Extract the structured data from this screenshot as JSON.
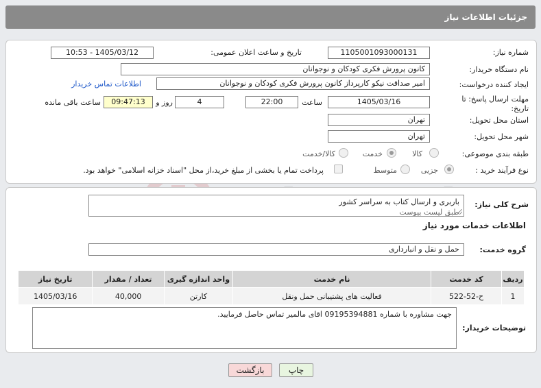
{
  "header": {
    "title": "جزئیات اطلاعات نیاز"
  },
  "form": {
    "need_number_label": "شماره نیاز:",
    "need_number": "1105001093000131",
    "announce_label": "تاریخ و ساعت اعلان عمومی:",
    "announce_value": "1405/03/12 - 10:53",
    "buyer_org_label": "نام دستگاه خریدار:",
    "buyer_org": "کانون پرورش فکری کودکان و نوجوانان",
    "creator_label": "ایجاد کننده درخواست:",
    "creator": "امیر صداقت نیکو کارپرداز کانون پرورش فکری کودکان و نوجوانان",
    "contact_link": "اطلاعات تماس خریدار",
    "deadline_label": "مهلت ارسال پاسخ: تا تاریخ:",
    "deadline_date": "1405/03/16",
    "time_label": "ساعت",
    "deadline_time": "22:00",
    "days_value": "4",
    "days_label": "روز و",
    "remaining_time": "09:47:13",
    "remaining_label": "ساعت باقی مانده",
    "province_label": "استان محل تحویل:",
    "province": "تهران",
    "city_label": "شهر محل تحویل:",
    "city": "تهران",
    "category_label": "طبقه بندی موضوعی:",
    "category_options": [
      "کالا",
      "خدمت",
      "کالا/خدمت"
    ],
    "category_selected": "خدمت",
    "process_label": "نوع فرآیند خرید :",
    "process_options": [
      "جزیی",
      "متوسط"
    ],
    "process_selected": "جزیی",
    "payment_note": "پرداخت تمام یا بخشی از مبلغ خرید،از محل \"اسناد خزانه اسلامی\" خواهد بود."
  },
  "description": {
    "label": "شرح کلی نیاز:",
    "line1": "باربری و ارسال کتاب به سراسر کشور",
    "line2": "طبق لیست پیوست"
  },
  "services": {
    "section_title": "اطلاعات خدمات مورد نیاز",
    "group_label": "گروه خدمت:",
    "group_value": "حمل و نقل و انبارداری",
    "columns": [
      "ردیف",
      "کد خدمت",
      "نام خدمت",
      "واحد اندازه گیری",
      "تعداد / مقدار",
      "تاریخ نیاز"
    ],
    "rows": [
      [
        "1",
        "ح-52-522",
        "فعالیت های پشتیبانی حمل ونقل",
        "کارتن",
        "40,000",
        "1405/03/16"
      ]
    ]
  },
  "notes": {
    "label": "توضیحات خریدار:",
    "text": "جهت مشاوره با شماره 09195394881 اقای مالمیر تماس حاصل فرمایید."
  },
  "buttons": {
    "print": "چاپ",
    "back": "بازگشت"
  },
  "watermark": {
    "text": "AriaTender.net"
  },
  "colors": {
    "header_bg": "#8a8a8a",
    "link": "#1a55c8",
    "remaining_bg": "#ffffcc",
    "back_btn": "#f8d8d8",
    "print_btn": "#e8f5e0"
  }
}
